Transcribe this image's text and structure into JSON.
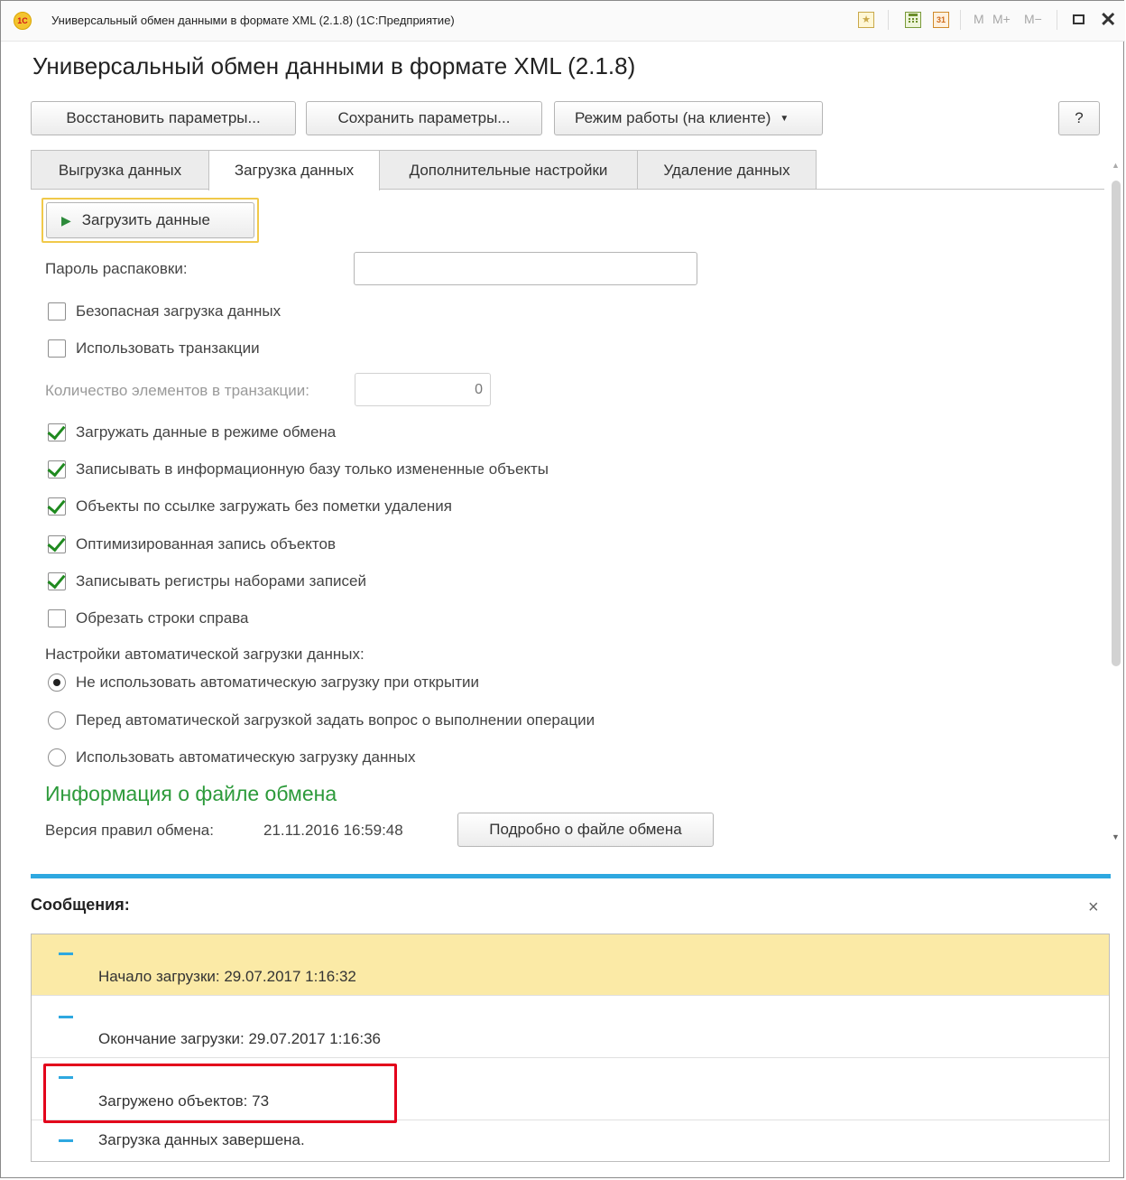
{
  "window": {
    "title": "Универсальный обмен данными в формате XML (2.1.8)  (1С:Предприятие)",
    "logo_text": "1С",
    "memory_buttons": [
      "M",
      "M+",
      "M−"
    ],
    "form_title": "Универсальный обмен данными в формате XML (2.1.8)"
  },
  "toolbar": {
    "restore_label": "Восстановить параметры...",
    "save_label": "Сохранить параметры...",
    "mode_label": "Режим работы (на клиенте)",
    "help_label": "?"
  },
  "tabs": [
    {
      "label": "Выгрузка данных",
      "active": false
    },
    {
      "label": "Загрузка данных",
      "active": true
    },
    {
      "label": "Дополнительные настройки",
      "active": false
    },
    {
      "label": "Удаление данных",
      "active": false
    }
  ],
  "load": {
    "load_button_label": "Загрузить данные",
    "password_label": "Пароль распаковки:",
    "password_value": "",
    "safe_load_label": "Безопасная загрузка данных",
    "use_transactions_label": "Использовать транзакции",
    "transaction_count_label": "Количество элементов в транзакции:",
    "transaction_count_value": "0",
    "exchange_mode_label": "Загружать данные в режиме обмена",
    "changed_only_label": "Записывать в информационную базу только измененные объекты",
    "no_deletion_mark_label": "Объекты по ссылке загружать без пометки удаления",
    "optimized_write_label": "Оптимизированная запись объектов",
    "register_sets_label": "Записывать регистры наборами записей",
    "trim_right_label": "Обрезать строки справа",
    "auto_settings_label": "Настройки автоматической загрузки данных:",
    "radio_no_auto": "Не использовать автоматическую загрузку при открытии",
    "radio_ask": "Перед автоматической загрузкой задать вопрос о выполнении операции",
    "radio_auto": "Использовать автоматическую загрузку данных",
    "info_section_title": "Информация о файле обмена",
    "rules_version_label": "Версия правил обмена:",
    "rules_version_value": "21.11.2016 16:59:48",
    "details_button_label": "Подробно о файле обмена"
  },
  "messages": {
    "title": "Сообщения:",
    "close_icon": "×",
    "items": [
      "Начало загрузки: 29.07.2017 1:16:32",
      "Окончание загрузки: 29.07.2017 1:16:36",
      "Загружено объектов: 73",
      "Загрузка данных завершена."
    ]
  },
  "colors": {
    "accent_blue": "#2ea8e0",
    "section_green": "#2c9a3a",
    "highlight_yellow": "#fbeaa6",
    "annotation_red": "#e3001b"
  }
}
